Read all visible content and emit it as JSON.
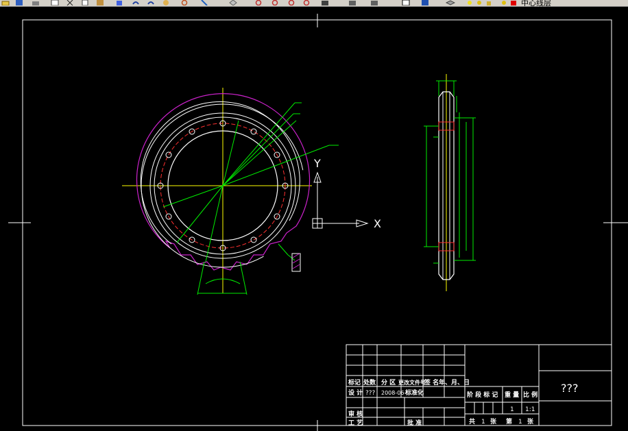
{
  "toolbar": {
    "layer_name": "中心线层",
    "icons": [
      "open-icon",
      "save-icon",
      "print-icon",
      "preview-icon",
      "cut-icon",
      "copy-icon",
      "paste-icon",
      "match-properties-icon",
      "undo-icon",
      "redo-icon",
      "pan-icon",
      "zoom-realtime-icon",
      "zoom-window-icon",
      "zoom-previous-icon",
      "properties-icon",
      "design-center-icon",
      "tool-palette-icon",
      "layer-manager-icon",
      "layer-state-icon",
      "layer-color-icon"
    ]
  },
  "drawing": {
    "ucs": {
      "x_label": "X",
      "y_label": "Y"
    },
    "title_block": {
      "drawing_name": "???",
      "row_headers": [
        "标记",
        "处数",
        "分 区",
        "更改文件号",
        "签 名",
        "年、月、日"
      ],
      "design_label": "设 计",
      "designer": "???",
      "date": "2008-06-",
      "standardize": "标准化",
      "review_label": "审 核",
      "process_label": "工 艺",
      "approve_label": "批 准",
      "stage_header": "阶 段 标 记",
      "weight_header": "重 量",
      "scale_header": "比 例",
      "quantity": "1",
      "scale": "1:1",
      "sheets_total_label": "共",
      "sheets_total": "1",
      "sheets_unit": "张",
      "sheet_no_label": "第",
      "sheet_no": "1",
      "sheet_unit": "张"
    }
  }
}
